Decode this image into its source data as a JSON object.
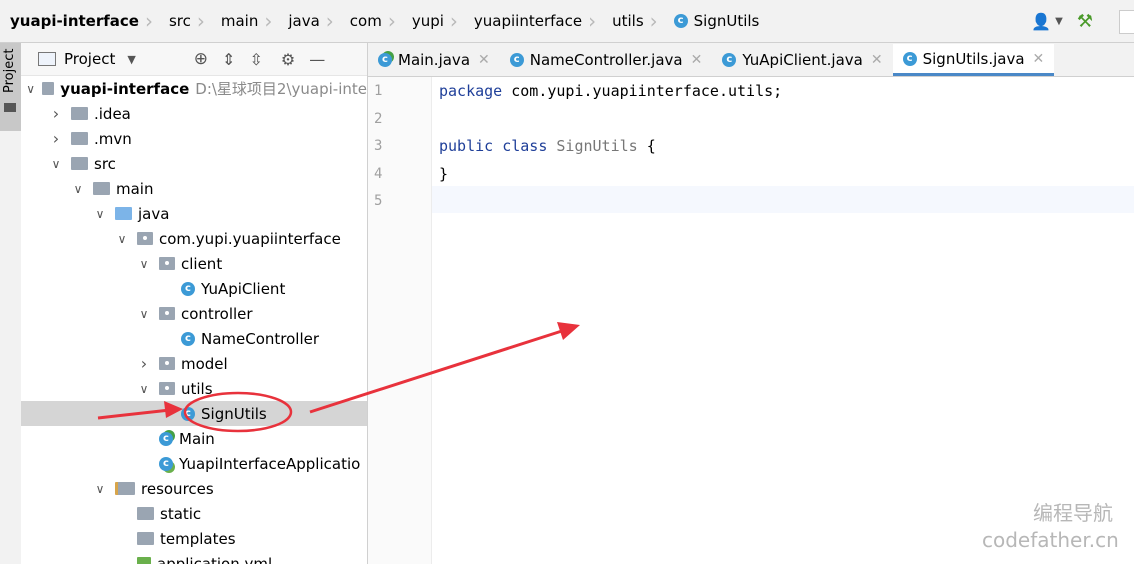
{
  "breadcrumb": [
    {
      "label": "yuapi-interface",
      "bold": true
    },
    {
      "label": "src"
    },
    {
      "label": "main"
    },
    {
      "label": "java"
    },
    {
      "label": "com"
    },
    {
      "label": "yupi"
    },
    {
      "label": "yuapiinterface"
    },
    {
      "label": "utils"
    },
    {
      "label": "SignUtils",
      "icon": "class-icon"
    }
  ],
  "left_strip": {
    "label": "Project"
  },
  "panel": {
    "title": "Project"
  },
  "tree": [
    {
      "label": "yuapi-interface",
      "bold": true,
      "path": "D:\\星球项目2\\yuapi-inte",
      "depth": 0,
      "expanded": true,
      "icon": "module-folder-icon"
    },
    {
      "label": ".idea",
      "depth": 1,
      "expanded": false,
      "icon": "folder-icon"
    },
    {
      "label": ".mvn",
      "depth": 1,
      "expanded": false,
      "icon": "folder-icon"
    },
    {
      "label": "src",
      "depth": 1,
      "expanded": true,
      "icon": "folder-icon"
    },
    {
      "label": "main",
      "depth": 2,
      "expanded": true,
      "icon": "folder-icon"
    },
    {
      "label": "java",
      "depth": 3,
      "expanded": true,
      "icon": "source-folder-icon"
    },
    {
      "label": "com.yupi.yuapiinterface",
      "depth": 4,
      "expanded": true,
      "icon": "package-icon"
    },
    {
      "label": "client",
      "depth": 5,
      "expanded": true,
      "icon": "package-icon"
    },
    {
      "label": "YuApiClient",
      "depth": 6,
      "icon": "class-icon"
    },
    {
      "label": "controller",
      "depth": 5,
      "expanded": true,
      "icon": "package-icon"
    },
    {
      "label": "NameController",
      "depth": 6,
      "icon": "class-icon"
    },
    {
      "label": "model",
      "depth": 5,
      "expanded": false,
      "icon": "package-icon"
    },
    {
      "label": "utils",
      "depth": 5,
      "expanded": true,
      "icon": "package-icon"
    },
    {
      "label": "SignUtils",
      "depth": 6,
      "icon": "class-icon",
      "selected": true
    },
    {
      "label": "Main",
      "depth": 5,
      "icon": "runnable-class-icon"
    },
    {
      "label": "YuapiInterfaceApplicatio",
      "depth": 5,
      "icon": "spring-boot-class-icon"
    },
    {
      "label": "resources",
      "depth": 3,
      "expanded": true,
      "icon": "resources-folder-icon"
    },
    {
      "label": "static",
      "depth": 4,
      "icon": "folder-icon"
    },
    {
      "label": "templates",
      "depth": 4,
      "icon": "folder-icon"
    },
    {
      "label": "application.yml",
      "depth": 4,
      "icon": "yaml-file-icon"
    }
  ],
  "tabs": [
    {
      "label": "Main.java",
      "icon": "runnable-class-icon"
    },
    {
      "label": "NameController.java",
      "icon": "class-icon"
    },
    {
      "label": "YuApiClient.java",
      "icon": "class-icon"
    },
    {
      "label": "SignUtils.java",
      "icon": "class-icon",
      "active": true
    }
  ],
  "editor": {
    "line_numbers": [
      "1",
      "2",
      "3",
      "4",
      "5"
    ],
    "code": [
      {
        "kw": "package",
        "rest": " com.yupi.yuapiinterface.utils;"
      },
      {
        "kw": "",
        "rest": ""
      },
      {
        "kw": "public class",
        "cls": " SignUtils",
        "rest": " {"
      },
      {
        "kw": "",
        "rest": "}"
      },
      {
        "kw": "",
        "rest": ""
      }
    ]
  },
  "watermark": {
    "line1": "编程导航",
    "line2": "codefather.cn"
  },
  "colors": {
    "accent": "#4a88c7",
    "annotation": "#e8323c",
    "keyword": "#1f3f99"
  }
}
